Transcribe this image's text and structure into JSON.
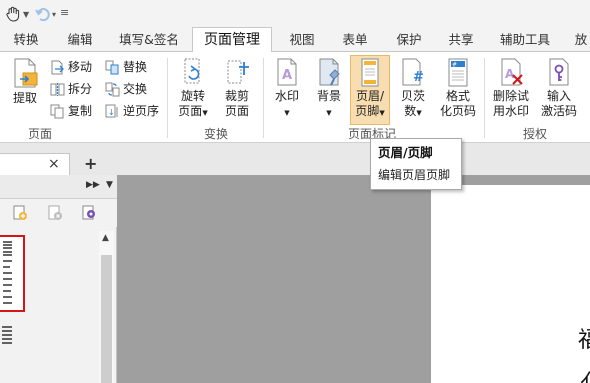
{
  "quick_access": {
    "hand_icon": "hand-tool-icon",
    "undo_icon": "undo-icon"
  },
  "tabs": [
    "转换",
    "编辑",
    "填写&签名",
    "页面管理",
    "视图",
    "表单",
    "保护",
    "共享",
    "辅助工具",
    "放"
  ],
  "active_tab": "页面管理",
  "ribbon": {
    "pages_group": {
      "extract": "提取",
      "move": "移动",
      "split": "拆分",
      "copy": "复制",
      "replace": "替换",
      "swap": "交换",
      "reverse": "逆页序",
      "label": "页面"
    },
    "transform_group": {
      "rotate_line1": "旋转",
      "rotate_line2": "页面",
      "crop_line1": "裁剪",
      "crop_line2": "页面",
      "label": "变换"
    },
    "mark_group": {
      "watermark": "水印",
      "background": "背景",
      "header_footer_line1": "页眉/",
      "header_footer_line2": "页脚",
      "bates_line1": "贝茨",
      "bates_line2": "数",
      "format_line1": "格式",
      "format_line2": "化页码",
      "label": "页面标记"
    },
    "license_group": {
      "remove_trial_line1": "删除试",
      "remove_trial_line2": "用水印",
      "activate_line1": "输入",
      "activate_line2": "激活码",
      "label": "授权"
    }
  },
  "document_tabs": {
    "close": "×",
    "add": "+"
  },
  "tooltip": {
    "title": "页眉/页脚",
    "description": "编辑页眉页脚"
  },
  "page_text": {
    "line1": "福",
    "line2": "亻"
  },
  "colors": {
    "accent": "#d4161b",
    "active_tab_bg": "#ffffff",
    "ribbon_icon_blue": "#2d7fd1",
    "ribbon_icon_purple": "#7a4fb7"
  }
}
